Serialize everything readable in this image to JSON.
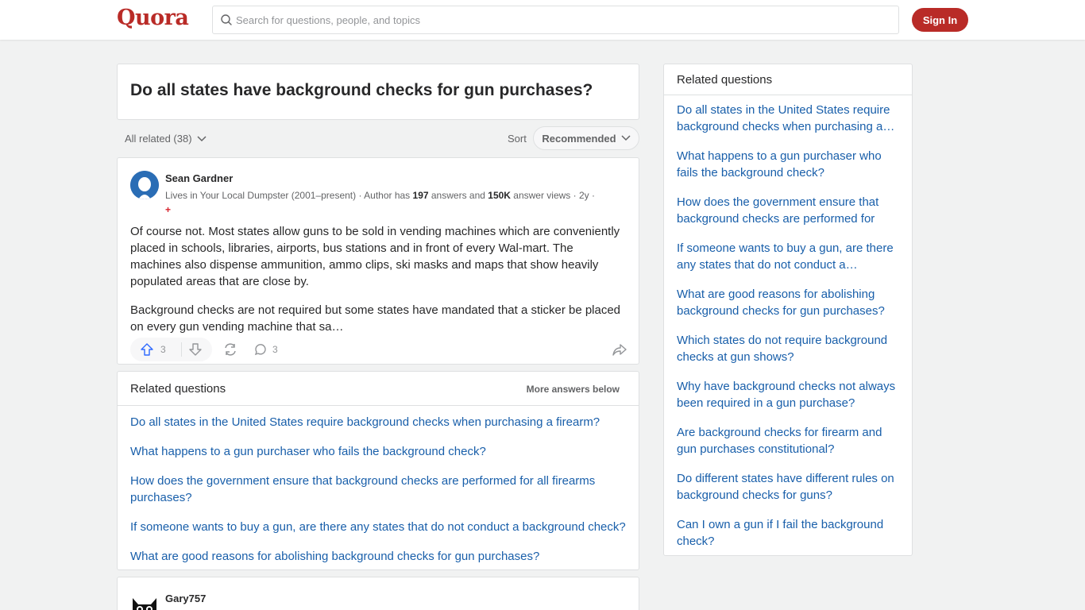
{
  "header": {
    "logo": "Quora",
    "search_placeholder": "Search for questions, people, and topics",
    "signin_label": "Sign In",
    "brand_color": "#b92b27"
  },
  "question": {
    "title": "Do all states have background checks for gun purchases?"
  },
  "filter": {
    "all_related": "All related (38)",
    "sort_label": "Sort",
    "sort_value": "Recommended"
  },
  "answer1": {
    "author": "Sean Gardner",
    "cred_prefix": "Lives in Your Local Dumpster (2001–present) · Author has ",
    "answers_count": "197",
    "cred_mid": " answers and ",
    "views_count": "150K",
    "cred_suffix": " answer views · 2y ·",
    "badge": "+",
    "paragraph1": "Of course not. Most states allow guns to be sold in vending machines which are conveniently placed in schools, libraries, airports, bus stations and in front of every Wal-mart. The machines also dispense ammunition, ammo clips, ski masks and maps that show heavily populated areas that are close by.",
    "paragraph2": "Background checks are not required but some states have mandated that a sticker be placed on every gun vending machine that sa…",
    "upvotes": "3",
    "comments": "3"
  },
  "related_main": {
    "title": "Related questions",
    "more": "More answers below",
    "items": [
      "Do all states in the United States require background checks when purchasing a firearm?",
      "What happens to a gun purchaser who fails the background check?",
      "How does the government ensure that background checks are performed for all firearms purchases?",
      "If someone wants to buy a gun, are there any states that do not conduct a background check?",
      "What are good reasons for abolishing background checks for gun purchases?"
    ]
  },
  "answer2": {
    "author": "Gary757"
  },
  "sidebar": {
    "title": "Related questions",
    "items": [
      "Do all states in the United States require background checks when purchasing a…",
      "What happens to a gun purchaser who fails the background check?",
      "How does the government ensure that background checks are performed for all…",
      "If someone wants to buy a gun, are there any states that do not conduct a…",
      "What are good reasons for abolishing background checks for gun purchases?",
      "Which states do not require background checks at gun shows?",
      "Why have background checks not always been required in a gun purchase?",
      "Are background checks for firearm and gun purchases constitutional?",
      "Do different states have different rules on background checks for guns?",
      "Can I own a gun if I fail the background check?"
    ]
  }
}
